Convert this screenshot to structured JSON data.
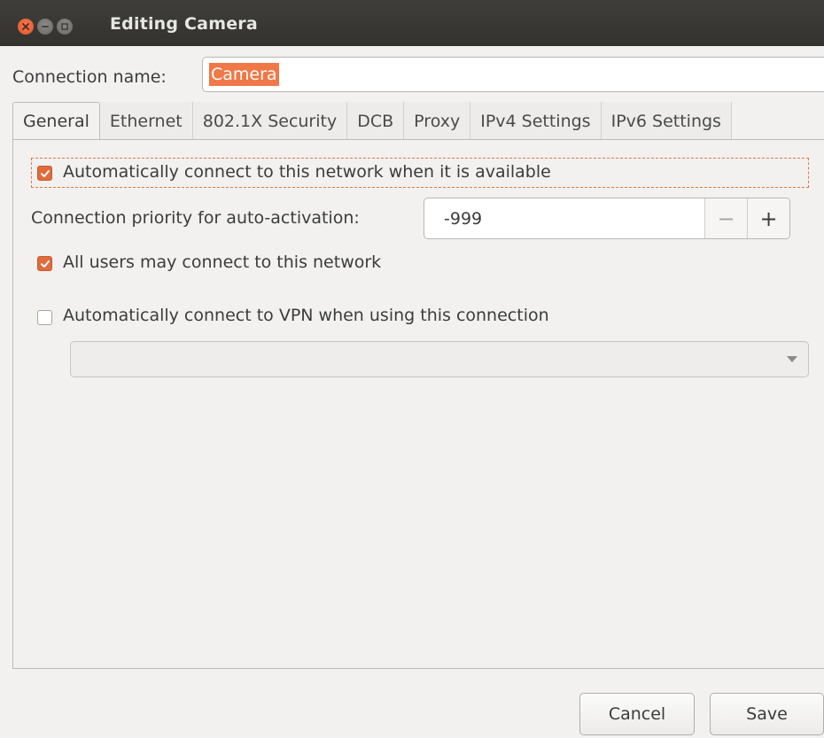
{
  "window": {
    "title": "Editing Camera"
  },
  "connection": {
    "label": "Connection name:",
    "value": "Camera"
  },
  "tabs": [
    {
      "label": "General",
      "active": true
    },
    {
      "label": "Ethernet",
      "active": false
    },
    {
      "label": "802.1X Security",
      "active": false
    },
    {
      "label": "DCB",
      "active": false
    },
    {
      "label": "Proxy",
      "active": false
    },
    {
      "label": "IPv4 Settings",
      "active": false
    },
    {
      "label": "IPv6 Settings",
      "active": false
    }
  ],
  "general": {
    "auto_connect": {
      "label": "Automatically connect to this network when it is available",
      "checked": true
    },
    "priority": {
      "label": "Connection priority for auto-activation:",
      "value": "-999",
      "minus": "−",
      "plus": "+"
    },
    "all_users": {
      "label": "All users may connect to this network",
      "checked": true
    },
    "vpn": {
      "label": "Automatically connect to VPN when using this connection",
      "checked": false,
      "selected": ""
    }
  },
  "buttons": {
    "cancel": "Cancel",
    "save": "Save"
  },
  "colors": {
    "accent": "#e06b3c",
    "titlebar": "#3a3935",
    "background": "#f2f1f0"
  }
}
